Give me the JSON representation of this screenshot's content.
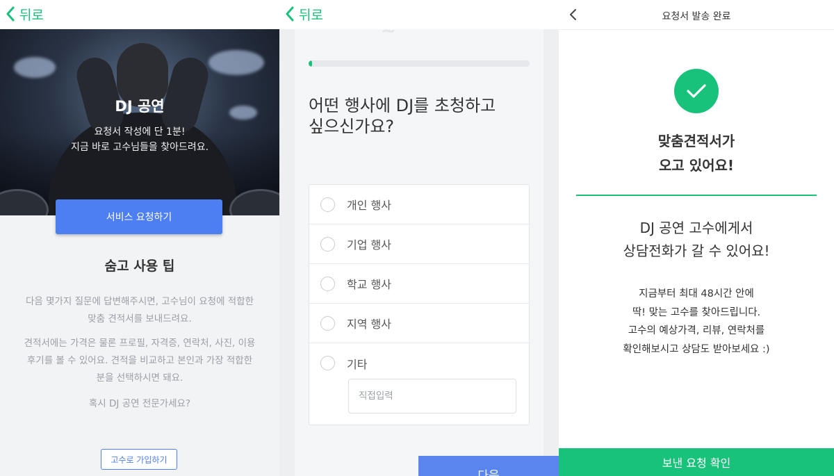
{
  "colors": {
    "green": "#19c27a",
    "blue": "#4e7ff2"
  },
  "panel1": {
    "back_label": "뒤로",
    "hero_title": "DJ 공연",
    "hero_line1": "요청서 작성에 단 1분!",
    "hero_line2": "지금 바로 고수님들을 찾아드려요.",
    "request_button": "서비스 요청하기",
    "tips_title": "숨고 사용 팁",
    "tips_p1_line1": "다음 몇가지 질문에 답변해주시면, 고수님이 요청에 적합한",
    "tips_p1_line2": "맞춤 견적서를 보내드려요.",
    "tips_p2_line1": "견적서에는 가격은 물론 프로필, 자격증, 연락처, 사진, 이용",
    "tips_p2_line2": "후기를 볼 수 있어요. 견적을 비교하고 본인과 가장 적합한",
    "tips_p2_line3": "분을 선택하시면 돼요.",
    "pro_question": "혹시 DJ 공연 전문가세요?",
    "signup_button": "고수로 가입하기"
  },
  "panel2": {
    "back_label": "뒤로",
    "progress": 0.01,
    "question_line1": "어떤 행사에 DJ를 초청하고",
    "question_line2": "싶으신가요?",
    "options": [
      "개인 행사",
      "기업 행사",
      "학교 행사",
      "지역 행사",
      "기타"
    ],
    "etc_placeholder": "직접입력",
    "next_button": "다음"
  },
  "panel3": {
    "title": "요청서 발송 완료",
    "done_line1": "맞춤견적서가",
    "done_line2": "오고 있어요!",
    "call_line1": "DJ 공연 고수에게서",
    "call_line2": "상담전화가 갈 수 있어요!",
    "info_line1": "지금부터 최대 48시간 안에",
    "info_line2": "딱! 맞는 고수를 찾아드립니다.",
    "info_line3": "고수의 예상가격, 리뷰, 연락처를",
    "info_line4": "확인해보시고 상담도 받아보세요 :)",
    "confirm_button": "보낸 요청 확인"
  }
}
